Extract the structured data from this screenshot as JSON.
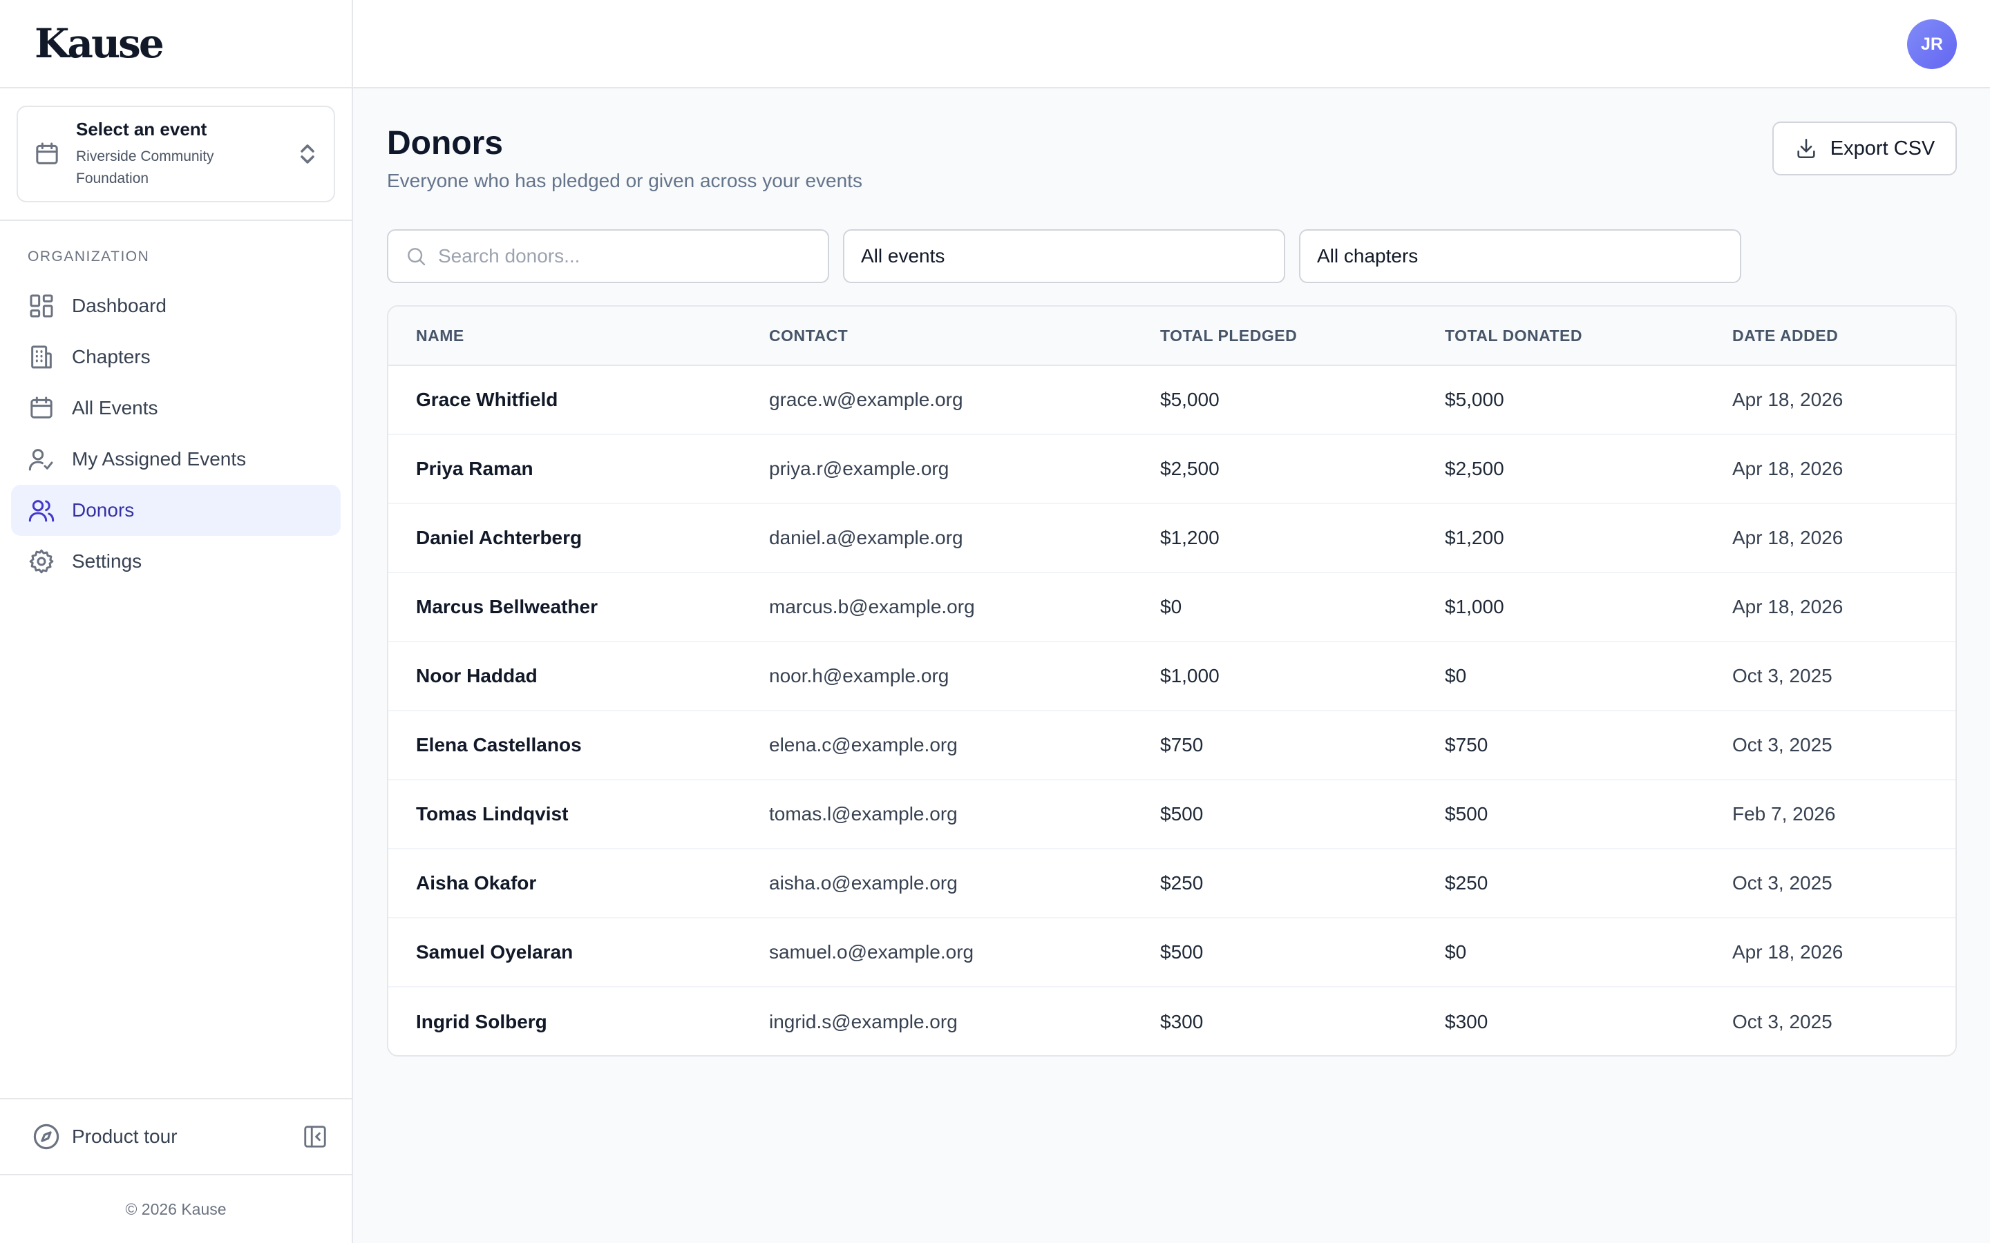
{
  "app": {
    "logo": "Kause"
  },
  "event_selector": {
    "title": "Select an event",
    "subtitle": "Riverside Community Foundation"
  },
  "nav": {
    "section_label": "ORGANIZATION",
    "items": [
      {
        "label": "Dashboard",
        "icon": "dashboard-icon",
        "active": false
      },
      {
        "label": "Chapters",
        "icon": "building-icon",
        "active": false
      },
      {
        "label": "All Events",
        "icon": "calendar-icon",
        "active": false
      },
      {
        "label": "My Assigned Events",
        "icon": "user-check-icon",
        "active": false
      },
      {
        "label": "Donors",
        "icon": "users-icon",
        "active": true
      },
      {
        "label": "Settings",
        "icon": "gear-icon",
        "active": false
      }
    ]
  },
  "sidebar_footer": {
    "tour_label": "Product tour",
    "copyright": "© 2026 Kause"
  },
  "user": {
    "initials": "JR"
  },
  "page": {
    "title": "Donors",
    "subtitle": "Everyone who has pledged or given across your events",
    "export_label": "Export CSV"
  },
  "filters": {
    "search_placeholder": "Search donors...",
    "event_value": "All events",
    "chapter_value": "All chapters"
  },
  "table": {
    "columns": [
      "NAME",
      "CONTACT",
      "TOTAL PLEDGED",
      "TOTAL DONATED",
      "DATE ADDED"
    ],
    "rows": [
      [
        "Grace Whitfield",
        "grace.w@example.org",
        "$5,000",
        "$5,000",
        "Apr 18, 2026"
      ],
      [
        "Priya Raman",
        "priya.r@example.org",
        "$2,500",
        "$2,500",
        "Apr 18, 2026"
      ],
      [
        "Daniel Achterberg",
        "daniel.a@example.org",
        "$1,200",
        "$1,200",
        "Apr 18, 2026"
      ],
      [
        "Marcus Bellweather",
        "marcus.b@example.org",
        "$0",
        "$1,000",
        "Apr 18, 2026"
      ],
      [
        "Noor Haddad",
        "noor.h@example.org",
        "$1,000",
        "$0",
        "Oct 3, 2025"
      ],
      [
        "Elena Castellanos",
        "elena.c@example.org",
        "$750",
        "$750",
        "Oct 3, 2025"
      ],
      [
        "Tomas Lindqvist",
        "tomas.l@example.org",
        "$500",
        "$500",
        "Feb 7, 2026"
      ],
      [
        "Aisha Okafor",
        "aisha.o@example.org",
        "$250",
        "$250",
        "Oct 3, 2025"
      ],
      [
        "Samuel Oyelaran",
        "samuel.o@example.org",
        "$500",
        "$0",
        "Apr 18, 2026"
      ],
      [
        "Ingrid Solberg",
        "ingrid.s@example.org",
        "$300",
        "$300",
        "Oct 3, 2025"
      ]
    ]
  },
  "colors": {
    "accent": "#4338ca",
    "active_bg": "#eef2ff",
    "avatar": "#6366f1"
  }
}
